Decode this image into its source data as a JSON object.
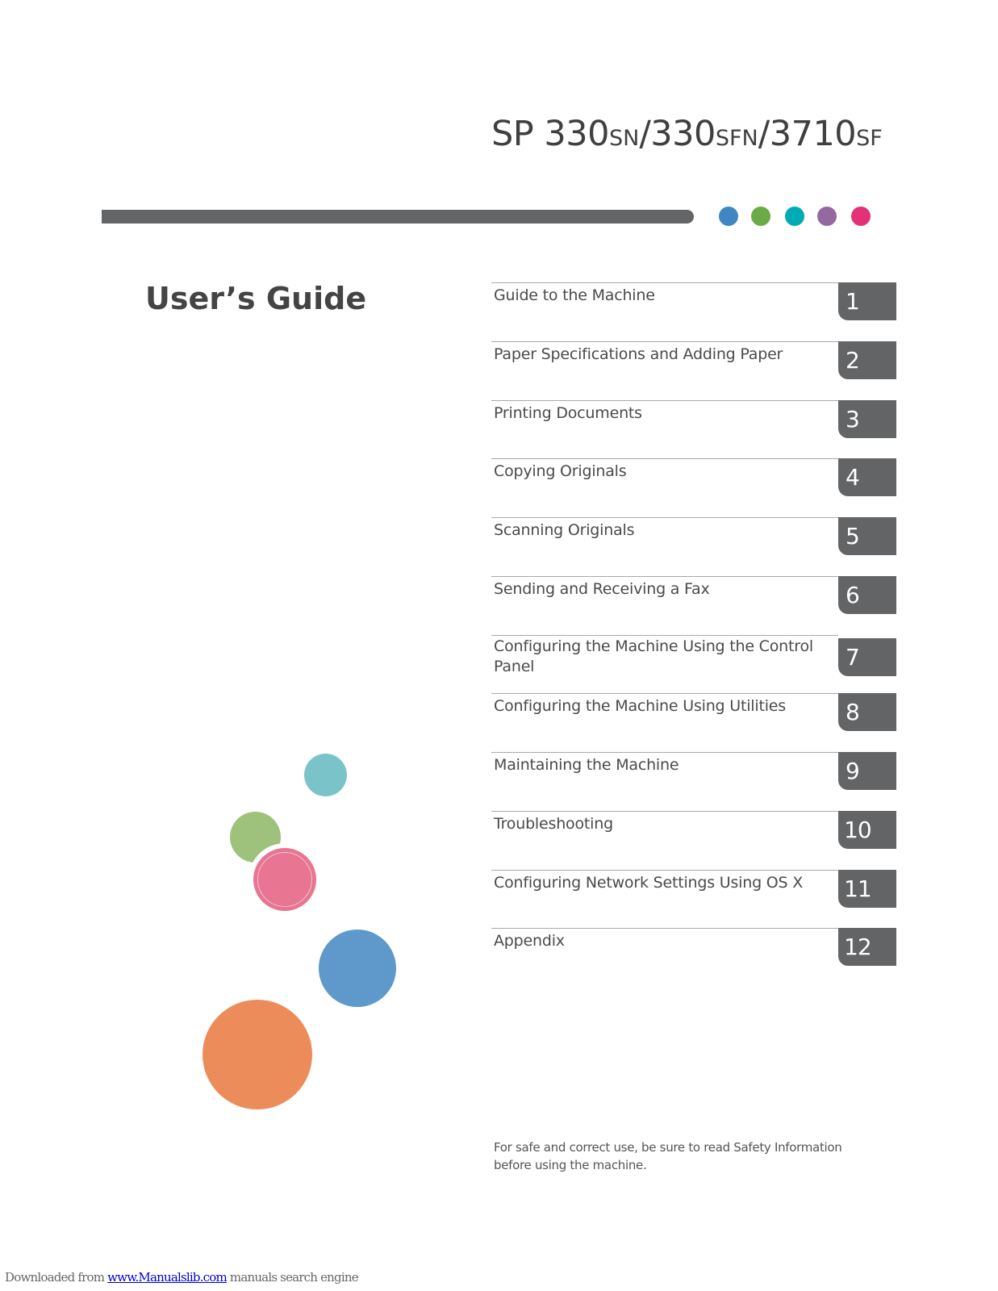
{
  "header": {
    "model_title": {
      "parts": [
        {
          "text": "SP 330",
          "suffix": false
        },
        {
          "text": "SN",
          "suffix": true
        },
        {
          "text": "/330",
          "suffix": false
        },
        {
          "text": "SFN",
          "suffix": true
        },
        {
          "text": "/3710",
          "suffix": false
        },
        {
          "text": "SF",
          "suffix": true
        }
      ]
    },
    "bar_color": "#646567",
    "dots": [
      {
        "name": "blue-dot",
        "color": "#3f86c4"
      },
      {
        "name": "green-dot",
        "color": "#6bab45"
      },
      {
        "name": "teal-dot",
        "color": "#00abb5"
      },
      {
        "name": "purple-dot",
        "color": "#94699f"
      },
      {
        "name": "magenta-dot",
        "color": "#e33076"
      }
    ]
  },
  "guide_title": "User’s Guide",
  "toc": {
    "tab_color": "#636466",
    "items": [
      {
        "number": "1",
        "label": "Guide to the Machine"
      },
      {
        "number": "2",
        "label": "Paper Specifications and Adding Paper"
      },
      {
        "number": "3",
        "label": "Printing Documents"
      },
      {
        "number": "4",
        "label": "Copying Originals"
      },
      {
        "number": "5",
        "label": "Scanning Originals"
      },
      {
        "number": "6",
        "label": "Sending and Receiving a Fax"
      },
      {
        "number": "7",
        "label": "Configuring the Machine Using the Control Panel"
      },
      {
        "number": "8",
        "label": "Configuring the Machine Using Utilities"
      },
      {
        "number": "9",
        "label": "Maintaining the Machine"
      },
      {
        "number": "10",
        "label": "Troubleshooting"
      },
      {
        "number": "11",
        "label": "Configuring Network Settings Using OS X"
      },
      {
        "number": "12",
        "label": "Appendix"
      }
    ]
  },
  "decor_circles": [
    {
      "name": "teal-circle",
      "color": "#7ac4c9"
    },
    {
      "name": "green-circle",
      "color": "#9ec17c"
    },
    {
      "name": "pink-circle",
      "color": "#e87592"
    },
    {
      "name": "blue-circle",
      "color": "#5f98ca"
    },
    {
      "name": "orange-circle",
      "color": "#ec8c5b"
    }
  ],
  "safety_note": "For safe and correct use, be sure to read Safety Information before using the machine.",
  "footer": {
    "prefix": "Downloaded from ",
    "link_text": "www.Manualslib.com",
    "suffix": "  manuals search engine"
  }
}
